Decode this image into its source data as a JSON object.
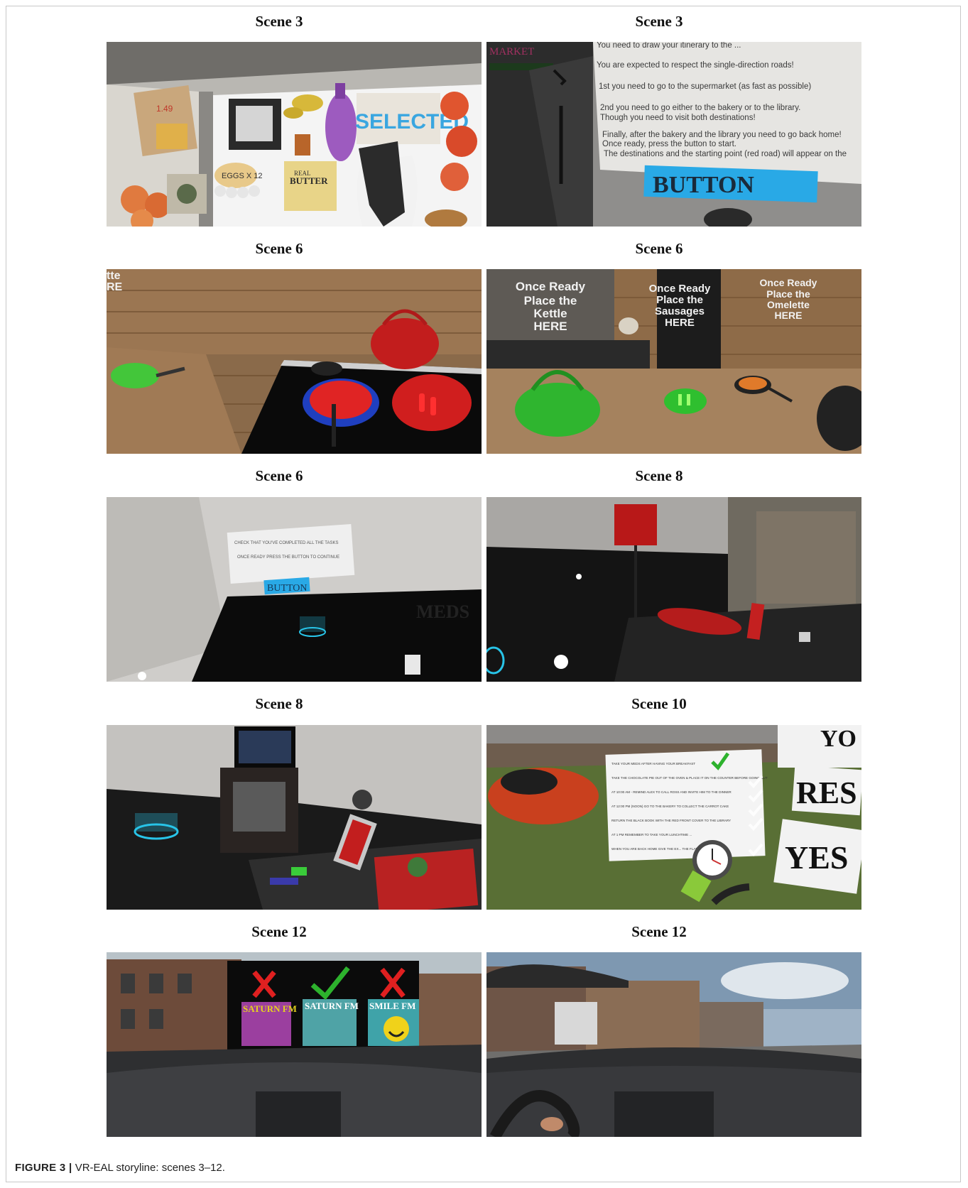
{
  "figure": {
    "caption_label": "FIGURE 3 |",
    "caption_text": "VR-EAL storyline: scenes 3–12."
  },
  "panels": [
    {
      "title": "Scene 3"
    },
    {
      "title": "Scene 3"
    },
    {
      "title": "Scene 6"
    },
    {
      "title": "Scene 6"
    },
    {
      "title": "Scene 6"
    },
    {
      "title": "Scene 8"
    },
    {
      "title": "Scene 8"
    },
    {
      "title": "Scene 10"
    },
    {
      "title": "Scene 12"
    },
    {
      "title": "Scene 12"
    }
  ],
  "overlays": {
    "p1": {
      "selected": "SELECTED",
      "eggs": "EGGS X 12",
      "butter": "BUTTER",
      "real": "REAL",
      "price": "1.49"
    },
    "p2": {
      "lines": [
        "You need to draw your itinerary to the ...",
        "You are expected to respect the single-direction roads!",
        "1st you need to go to the supermarket (as fast as possible)",
        "2nd you need to go either to the bakery or to the library.",
        "Though you need to visit both destinations!",
        "Finally, after the bakery and the library you need to go back home!",
        "Once ready, press the button to start.",
        "The destinations and the starting point (red road) will appear on the"
      ],
      "button": "BUTTON",
      "market": "MARKET"
    },
    "p3": {
      "corner": "tte",
      "corner2": "RE"
    },
    "p4": {
      "sign1": [
        "Once Ready",
        "Place the",
        "Kettle",
        "HERE"
      ],
      "sign2": [
        "Once Ready",
        "Place the",
        "Sausages",
        "HERE"
      ],
      "sign3": [
        "Once Ready",
        "Place the",
        "Omelette",
        "HERE"
      ]
    },
    "p5": {
      "line1": "CHECK THAT YOU'VE COMPLETED ALL THE TASKS",
      "line2": "ONCE READY PRESS THE BUTTON TO CONTINUE",
      "button": "BUTTON",
      "meds": "MEDS"
    },
    "p8": {
      "tasks": [
        "TAKE YOUR MEDS AFTER HAVING YOUR BREAKFAST",
        "TAKE THE CHOCOLATE PIE OUT OF THE OVEN & PLACE IT ON THE COUNTER BEFORE GOING OUT",
        "AT 10:00 AM - REMIND ALEX TO CALL ROSS AND INVITE HIM TO THE DINNER",
        "AT 12:00 PM (NOON) GO TO THE BAKERY TO COLLECT THE CARROT CAKE",
        "RETURN THE BLACK BOOK WITH THE RED FRONT COVER TO THE LIBRARY",
        "AT 1 PM REMEMBER TO TAKE YOUR LUNCHTIME ...",
        "WHEN YOU ARE BACK HOME GIVE THE EX... THE FLAT TO RENT"
      ],
      "res": "RES",
      "yes": "YES",
      "partial": "YO"
    },
    "p9": {
      "station1": "SATURN FM",
      "station2": "SATURN FM",
      "station3": "SMILE FM"
    }
  },
  "colors": {
    "selected_blue": "#3aa6e0",
    "button_blue": "#29a9e6",
    "check_green": "#2db22d",
    "cross_red": "#e02020"
  }
}
